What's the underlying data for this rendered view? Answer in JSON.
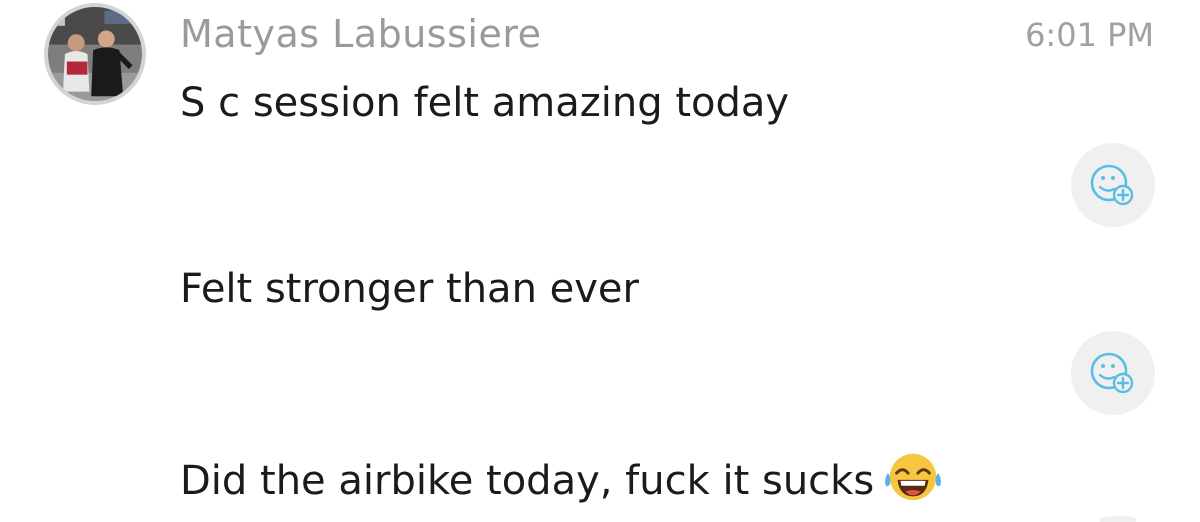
{
  "message_group": {
    "sender_name": "Matyas Labussiere",
    "timestamp": "6:01 PM",
    "messages": [
      {
        "text": "S c session felt amazing today"
      },
      {
        "text": "Felt stronger than ever"
      },
      {
        "text": "Did the airbike today, fuck it sucks",
        "emoji": "tears-of-joy-emoji-icon"
      }
    ]
  },
  "icons": {
    "avatar": "user-avatar-photo",
    "reaction": "add-reaction-icon"
  },
  "colors": {
    "sender": "#9a9a9a",
    "timestamp": "#a0a0a0",
    "message_text": "#1b1b1b",
    "reaction_icon": "#5bbde4",
    "reaction_bg": "#f0f0f0"
  }
}
